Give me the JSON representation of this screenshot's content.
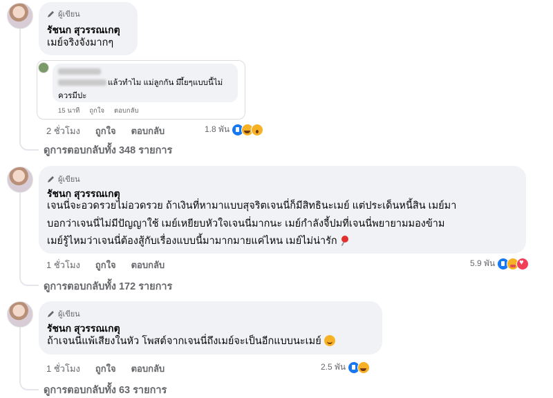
{
  "comments": [
    {
      "author_badge": "ผู้เขียน",
      "author": "รัชนก สุวรรณเกตุ",
      "lines": [
        "เมย์จริงจังมากๆ"
      ],
      "time": "2 ชั่วโมง",
      "like_label": "ถูกใจ",
      "reply_label": "ตอบกลับ",
      "reaction_count": "1.8 พัน",
      "reactions": [
        "like-icon",
        "haha-icon",
        "wow-icon"
      ],
      "view_replies": "ดูการตอบกลับทั้ง 348 รายการ",
      "nested_preview": {
        "text_line1": "แล้วทำไม แม่ลูกกัน มีเี้ยๆแบบนี้ไม่",
        "text_line2": "ควรมีปะ",
        "time": "15 นาที",
        "like_label": "ถูกใจ",
        "reply_label": "ตอบกลับ"
      }
    },
    {
      "author_badge": "ผู้เขียน",
      "author": "รัชนก สุวรรณเกตุ",
      "lines": [
        "เจนนี่จะอวดรวยไม่อวดรวย ถ้าเงินที่หามาแบบสุจริตเจนนี่ก็มีสิทธินะเมย์ แต่ประเด็นหนี้สิน เมย์มา",
        "บอกว่าเจนนี่ไม่มีปัญญาใช้ เมย์เหยียบหัวใจเจนนี่มากนะ เมย์กำลังจี้ปมที่เจนนี่พยายามมองข้าม",
        "เมย์รู้ไหมว่าเจนนี่ต้องสู้กับเรื่องแบบนี้มามากมายแค่ไหน เมย์ไม่น่ารัก"
      ],
      "time": "1 ชั่วโมง",
      "like_label": "ถูกใจ",
      "reply_label": "ตอบกลับ",
      "reaction_count": "5.9 พัน",
      "reactions": [
        "like-icon",
        "care-icon",
        "love-icon"
      ],
      "view_replies": "ดูการตอบกลับทั้ง 172 รายการ"
    },
    {
      "author_badge": "ผู้เขียน",
      "author": "รัชนก สุวรรณเกตุ",
      "lines": [
        "ถ้าเจนนี่แพ้เสียงในหัว โพสต์จากเจนนี่ถึงเมย์จะเป็นอีกแบบนะเมย์"
      ],
      "time": "1 ชั่วโมง",
      "like_label": "ถูกใจ",
      "reply_label": "ตอบกลับ",
      "reaction_count": "2.5 พัน",
      "reactions": [
        "like-icon",
        "haha-icon"
      ],
      "view_replies": "ดูการตอบกลับทั้ง 63 รายการ"
    }
  ],
  "colors": {
    "bubble": "#f0f2f5",
    "secondary_text": "#65676b",
    "like_blue": "#1877f2"
  }
}
